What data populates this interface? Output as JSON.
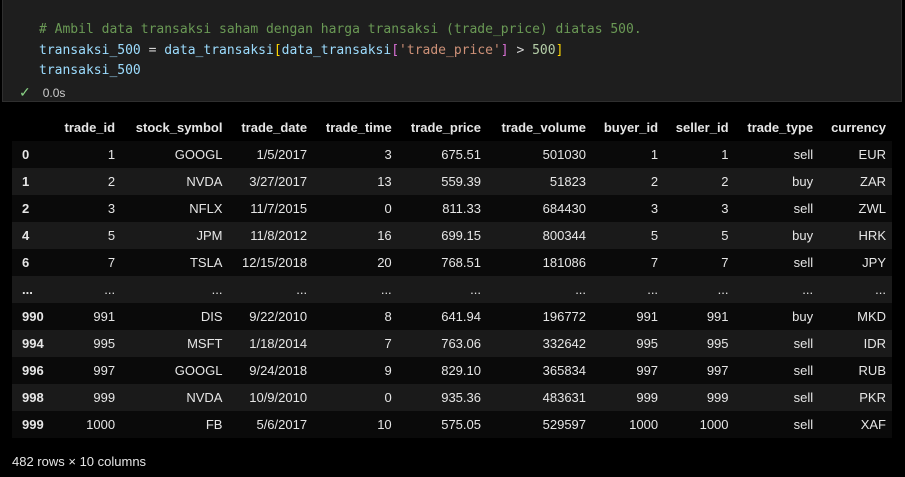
{
  "code": {
    "line1": "# Ambil data transaksi saham dengan harga transaksi (trade_price) diatas 500.",
    "var_name": "transaksi_500",
    "assign": " = ",
    "df": "data_transaksi",
    "col": "'trade_price'",
    "op": " > ",
    "threshold": "500",
    "line3": "transaksi_500"
  },
  "status": {
    "exec_time": "0.0s"
  },
  "table": {
    "columns": [
      "",
      "trade_id",
      "stock_symbol",
      "trade_date",
      "trade_time",
      "trade_price",
      "trade_volume",
      "buyer_id",
      "seller_id",
      "trade_type",
      "currency"
    ],
    "rows": [
      [
        "0",
        "1",
        "GOOGL",
        "1/5/2017",
        "3",
        "675.51",
        "501030",
        "1",
        "1",
        "sell",
        "EUR"
      ],
      [
        "1",
        "2",
        "NVDA",
        "3/27/2017",
        "13",
        "559.39",
        "51823",
        "2",
        "2",
        "buy",
        "ZAR"
      ],
      [
        "2",
        "3",
        "NFLX",
        "11/7/2015",
        "0",
        "811.33",
        "684430",
        "3",
        "3",
        "sell",
        "ZWL"
      ],
      [
        "4",
        "5",
        "JPM",
        "11/8/2012",
        "16",
        "699.15",
        "800344",
        "5",
        "5",
        "buy",
        "HRK"
      ],
      [
        "6",
        "7",
        "TSLA",
        "12/15/2018",
        "20",
        "768.51",
        "181086",
        "7",
        "7",
        "sell",
        "JPY"
      ],
      [
        "...",
        "...",
        "...",
        "...",
        "...",
        "...",
        "...",
        "...",
        "...",
        "...",
        "..."
      ],
      [
        "990",
        "991",
        "DIS",
        "9/22/2010",
        "8",
        "641.94",
        "196772",
        "991",
        "991",
        "buy",
        "MKD"
      ],
      [
        "994",
        "995",
        "MSFT",
        "1/18/2014",
        "7",
        "763.06",
        "332642",
        "995",
        "995",
        "sell",
        "IDR"
      ],
      [
        "996",
        "997",
        "GOOGL",
        "9/24/2018",
        "9",
        "829.10",
        "365834",
        "997",
        "997",
        "sell",
        "RUB"
      ],
      [
        "998",
        "999",
        "NVDA",
        "10/9/2010",
        "0",
        "935.36",
        "483631",
        "999",
        "999",
        "sell",
        "PKR"
      ],
      [
        "999",
        "1000",
        "FB",
        "5/6/2017",
        "10",
        "575.05",
        "529597",
        "1000",
        "1000",
        "sell",
        "XAF"
      ]
    ]
  },
  "footer": {
    "summary": "482 rows × 10 columns"
  }
}
